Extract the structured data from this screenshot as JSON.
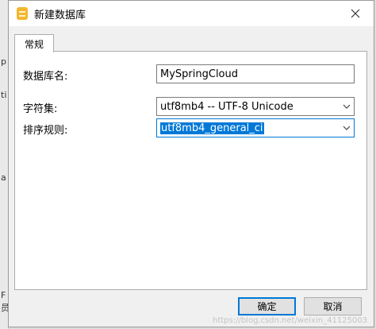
{
  "window": {
    "title": "新建数据库"
  },
  "tabs": [
    {
      "label": "常规"
    }
  ],
  "form": {
    "db_name_label": "数据库名:",
    "db_name_value": "MySpringCloud",
    "charset_label": "字符集:",
    "charset_value": "utf8mb4 -- UTF-8 Unicode",
    "collation_label": "排序规则:",
    "collation_value": "utf8mb4_general_ci"
  },
  "buttons": {
    "ok": "确定",
    "cancel": "取消"
  },
  "background": {
    "glyphs": [
      "p",
      "ti",
      "a",
      "F",
      "员"
    ]
  },
  "watermark": "https://blog.csdn.net/weixin_41125003",
  "colors": {
    "focus": "#0078d7",
    "icon": "#f2b630"
  }
}
